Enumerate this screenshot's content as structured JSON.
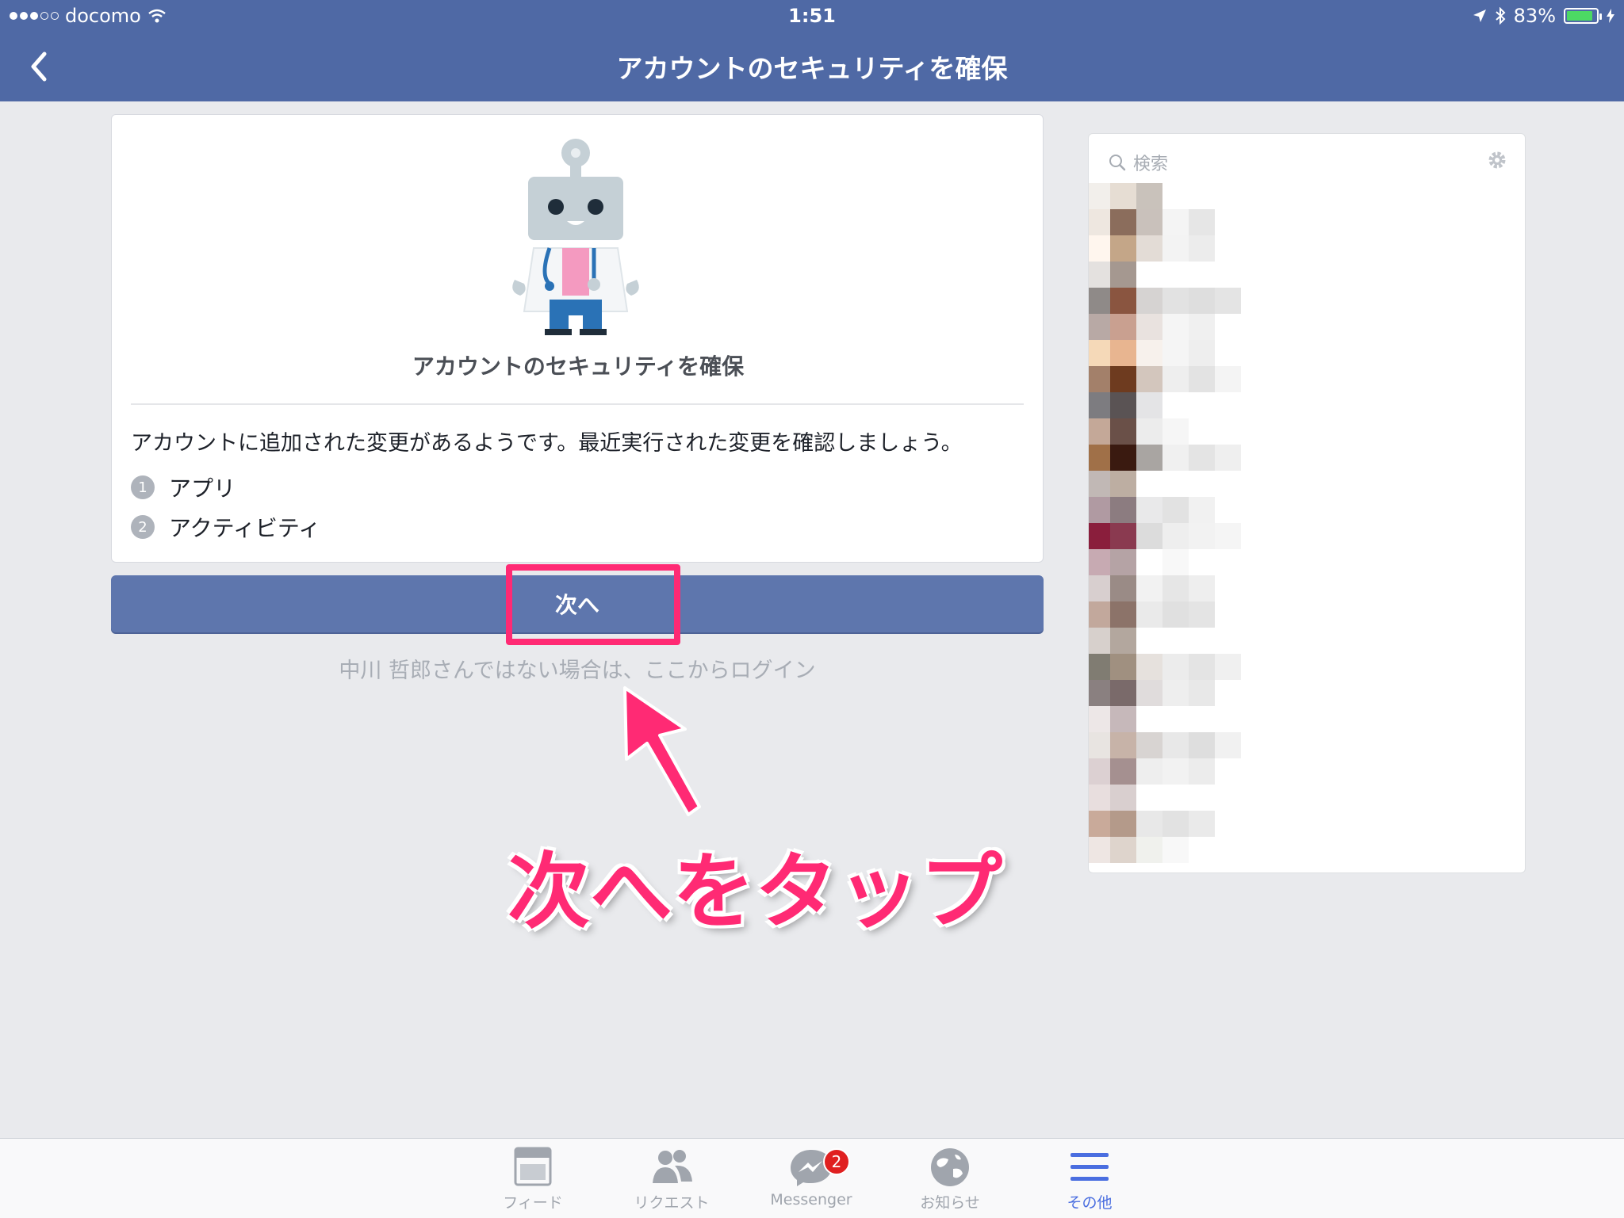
{
  "status_bar": {
    "carrier": "docomo",
    "time": "1:51",
    "battery": "83%"
  },
  "nav": {
    "title": "アカウントのセキュリティを確保",
    "back_icon": "chevron-left-icon"
  },
  "card": {
    "title": "アカウントのセキュリティを確保",
    "description": "アカウントに追加された変更があるようです。最近実行された変更を確認しましょう。",
    "items": [
      {
        "num": "1",
        "label": "アプリ"
      },
      {
        "num": "2",
        "label": "アクティビティ"
      }
    ]
  },
  "next_button": {
    "label": "次へ"
  },
  "alt_login": "中川 哲郎さんではない場合は、ここからログイン",
  "annotation": {
    "text": "次へをタップ",
    "color": "#ff2a74"
  },
  "side": {
    "search_placeholder": "検索"
  },
  "tabs": [
    {
      "label": "フィード",
      "icon": "feed-icon"
    },
    {
      "label": "リクエスト",
      "icon": "friend-requests-icon"
    },
    {
      "label": "Messenger",
      "icon": "messenger-icon",
      "badge": "2"
    },
    {
      "label": "お知らせ",
      "icon": "globe-icon"
    },
    {
      "label": "その他",
      "icon": "menu-icon",
      "active": true
    }
  ],
  "colors": {
    "header": "#4f69a5",
    "button": "#5e76ad",
    "active_tab": "#4a6ee0"
  }
}
